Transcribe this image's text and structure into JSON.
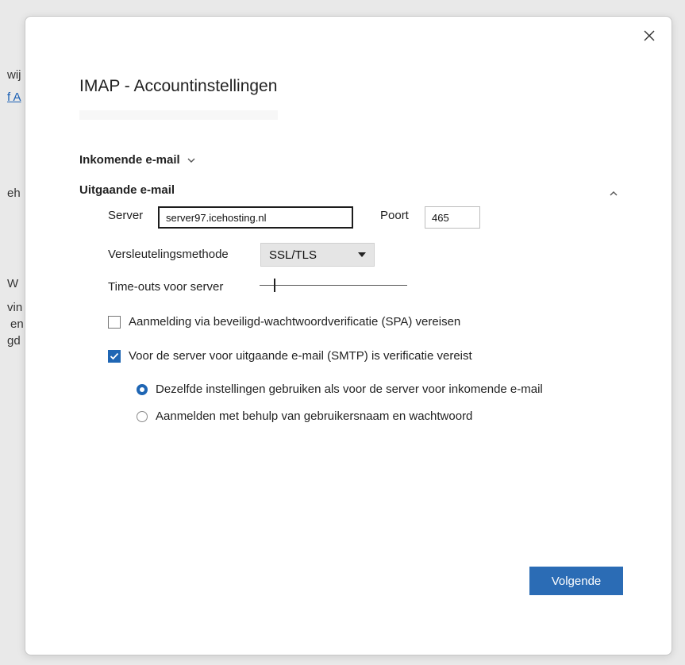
{
  "background_fragments": [
    "wij",
    "f A",
    "eh",
    "W",
    "vin",
    "en",
    "gd"
  ],
  "dialog": {
    "close_icon": "close-icon",
    "title": "IMAP - Accountinstellingen",
    "incoming": {
      "label": "Inkomende e-mail",
      "icon": "chevron-down-icon"
    },
    "outgoing": {
      "label": "Uitgaande e-mail",
      "collapse_icon": "chevron-up-icon",
      "server_label": "Server",
      "server_value": "server97.icehosting.nl",
      "port_label": "Poort",
      "port_value": "465",
      "encryption_label": "Versleutelingsmethode",
      "encryption_value": "SSL/TLS",
      "timeout_label": "Time-outs voor server",
      "timeout_level": 0.1,
      "spa_label": "Aanmelding via beveiligd-wachtwoordverificatie (SPA) vereisen",
      "spa_checked": false,
      "smtp_auth_label": "Voor de server voor uitgaande e-mail (SMTP) is verificatie vereist",
      "smtp_auth_checked": true,
      "radio_same_label": "Dezelfde instellingen gebruiken als voor de server voor inkomende e-mail",
      "radio_same_selected": true,
      "radio_user_label": "Aanmelden met behulp van gebruikersnaam en wachtwoord",
      "radio_user_selected": false
    },
    "next_button": "Volgende"
  },
  "colors": {
    "accent": "#2b6cb5",
    "checkbox": "#1f66b4"
  }
}
